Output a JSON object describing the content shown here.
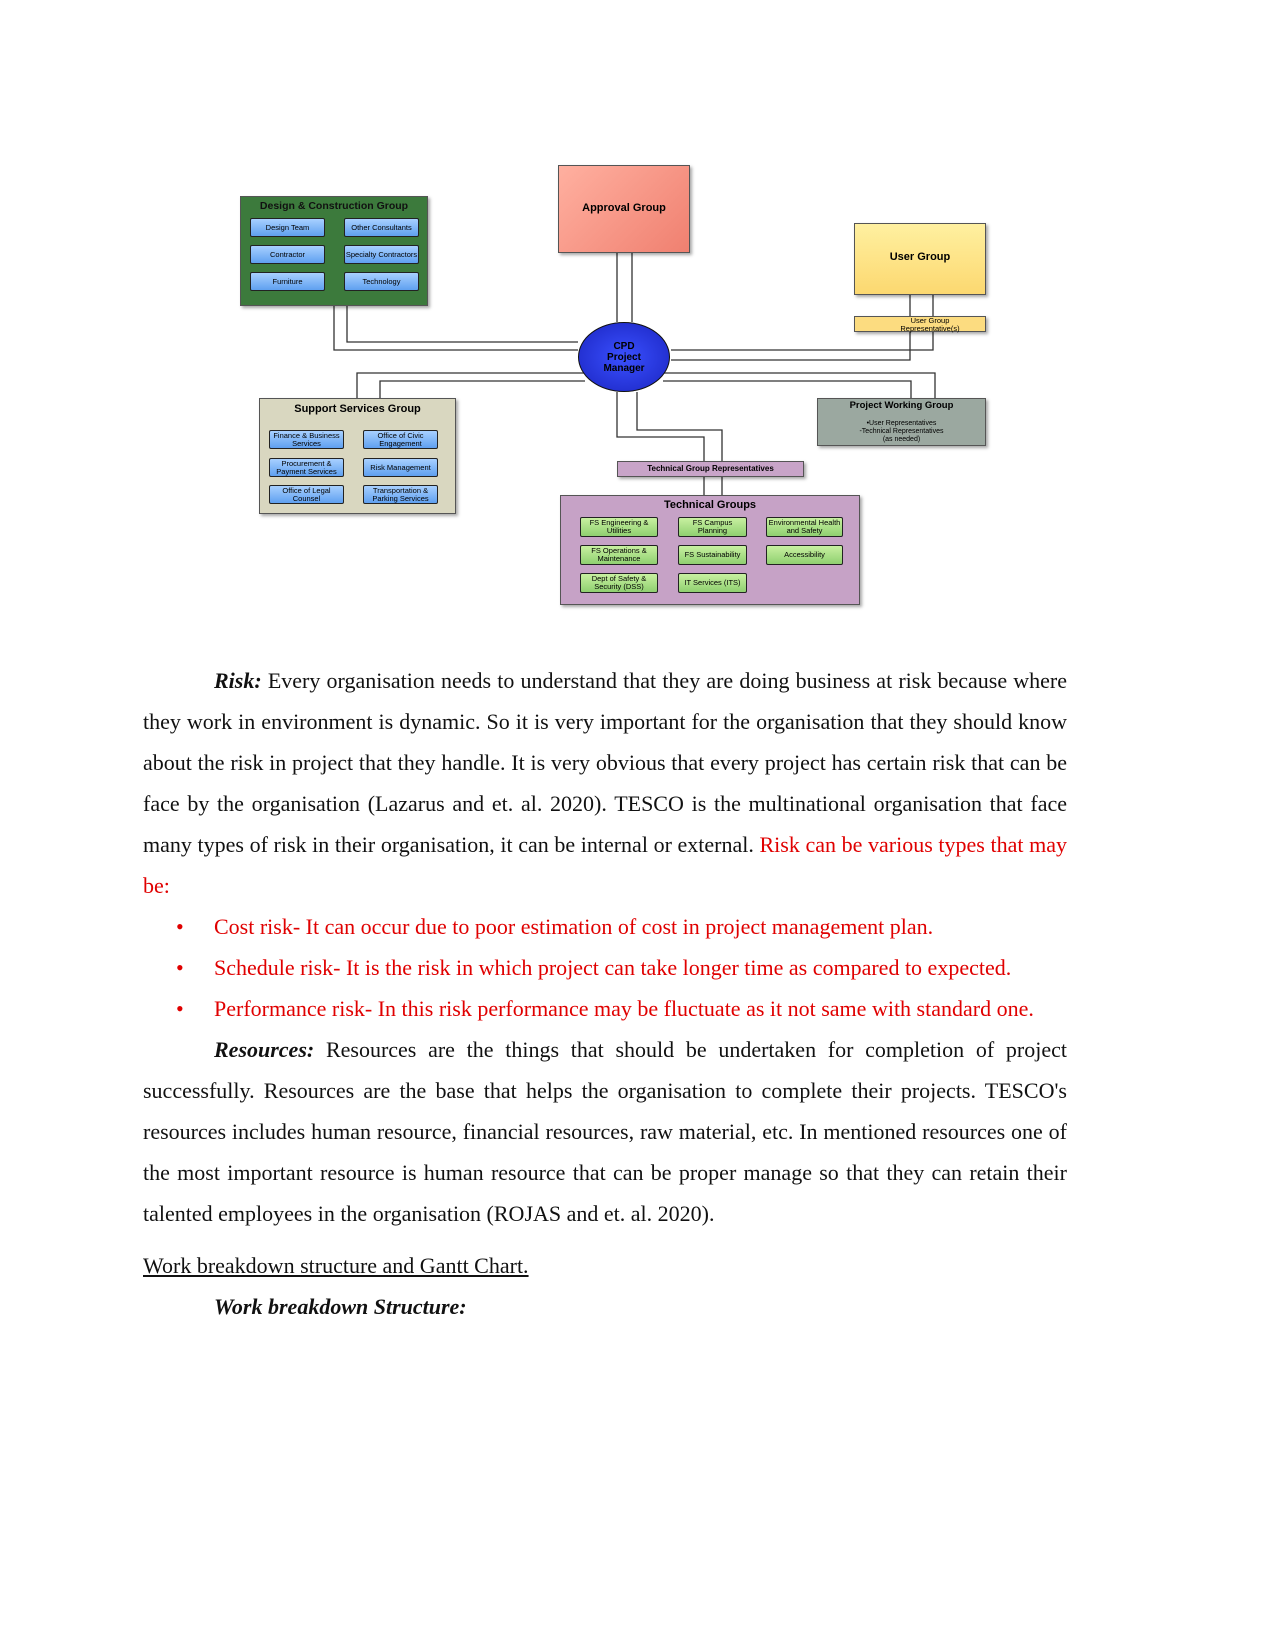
{
  "diagram": {
    "design_group": {
      "title": "Design & Construction Group",
      "items": [
        "Design Team",
        "Other Consultants",
        "Contractor",
        "Specialty Contractors",
        "Furniture",
        "Technology"
      ]
    },
    "approval_group": "Approval Group",
    "user_group": "User Group",
    "user_group_reps": "User Group Representative(s)",
    "cpd": "CPD Project Manager",
    "support_group": {
      "title": "Support Services Group",
      "items": [
        "Finance & Business Services",
        "Office of Civic Engagement",
        "Procurement & Payment Services",
        "Risk Management",
        "Office of Legal Counsel",
        "Transportation & Parking Services"
      ]
    },
    "project_working_group": {
      "title": "Project Working Group",
      "lines": [
        "•User Representatives",
        "-Technical Representatives",
        "(as needed)"
      ]
    },
    "tech_reps": "Technical Group Representatives",
    "tech_groups": {
      "title": "Technical Groups",
      "items": [
        "FS Engineering & Utilities",
        "FS Campus Planning",
        "Environmental Health and Safety",
        "FS Operations & Maintenance",
        "FS Sustainability",
        "Accessibility",
        "Dept of Safety & Security (DSS)",
        "IT Services (ITS)"
      ]
    }
  },
  "body": {
    "risk_label": "Risk:",
    "risk_text": " Every organisation needs to understand that they are doing business at risk because where they work in environment is dynamic. So it is very important for the organisation that they should know about the risk in project that they handle. It is very obvious that every project has certain risk that can be face by the organisation (Lazarus and et. al. 2020). TESCO is the multinational organisation that face many types of risk in their organisation, it can be internal or external. ",
    "risk_red": "Risk can be various types that may be:",
    "bullets": [
      "Cost risk- It can occur due to poor estimation of cost in project management plan.",
      "Schedule risk- It is the risk in which project can take longer time as compared to expected.",
      "Performance risk- In this risk performance may be fluctuate as it not same with standard one."
    ],
    "resources_label": "Resources:",
    "resources_text": " Resources are the things that should be undertaken for completion of project successfully. Resources are the base that helps the organisation to complete their projects. TESCO's resources includes human resource, financial resources, raw material, etc. In mentioned resources one of the most important resource is human resource that can be proper manage so that they can retain their talented employees in the organisation (ROJAS and et. al. 2020).",
    "heading": "Work breakdown structure and Gantt Chart.",
    "subheading": "Work breakdown Structure:"
  }
}
